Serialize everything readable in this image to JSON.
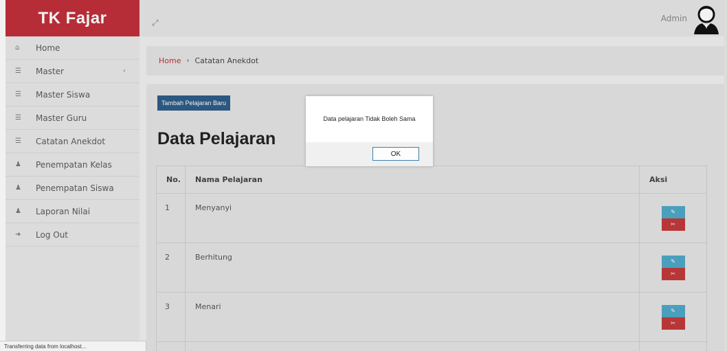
{
  "brand": "TK Fajar",
  "menu": [
    {
      "icon": "home-icon",
      "glyph": "⌂",
      "label": "Home",
      "chevron": ""
    },
    {
      "icon": "list-icon",
      "glyph": "☰",
      "label": "Master",
      "chevron": "‹"
    },
    {
      "icon": "list-icon",
      "glyph": "☰",
      "label": "Master Siswa",
      "chevron": ""
    },
    {
      "icon": "list-icon",
      "glyph": "☰",
      "label": "Master Guru",
      "chevron": ""
    },
    {
      "icon": "list-icon",
      "glyph": "☰",
      "label": "Catatan Anekdot",
      "chevron": ""
    },
    {
      "icon": "user-icon",
      "glyph": "♟",
      "label": "Penempatan Kelas",
      "chevron": ""
    },
    {
      "icon": "user-icon",
      "glyph": "♟",
      "label": "Penempatan Siswa",
      "chevron": ""
    },
    {
      "icon": "user-icon",
      "glyph": "♟",
      "label": "Laporan Nilai",
      "chevron": ""
    },
    {
      "icon": "logout-icon",
      "glyph": "➜",
      "label": "Log Out",
      "chevron": ""
    }
  ],
  "topbar": {
    "expand_glyph": "⤢",
    "user_label": "Admin"
  },
  "breadcrumb": {
    "home": "Home",
    "separator": "›",
    "current": "Catatan Anekdot"
  },
  "panel": {
    "add_button": "Tambah Pelajaran Baru",
    "title": "Data Pelajaran",
    "columns": [
      "No.",
      "Nama Pelajaran",
      "Aksi"
    ],
    "rows": [
      {
        "no": "1",
        "name": "Menyanyi"
      },
      {
        "no": "2",
        "name": "Berhitung"
      },
      {
        "no": "3",
        "name": "Menari"
      }
    ],
    "edit_glyph": "✎",
    "delete_glyph": "✂"
  },
  "dialog": {
    "message": "Data pelajaran Tidak Boleh Sama",
    "ok": "OK"
  },
  "status": "Transferring data from localhost..."
}
